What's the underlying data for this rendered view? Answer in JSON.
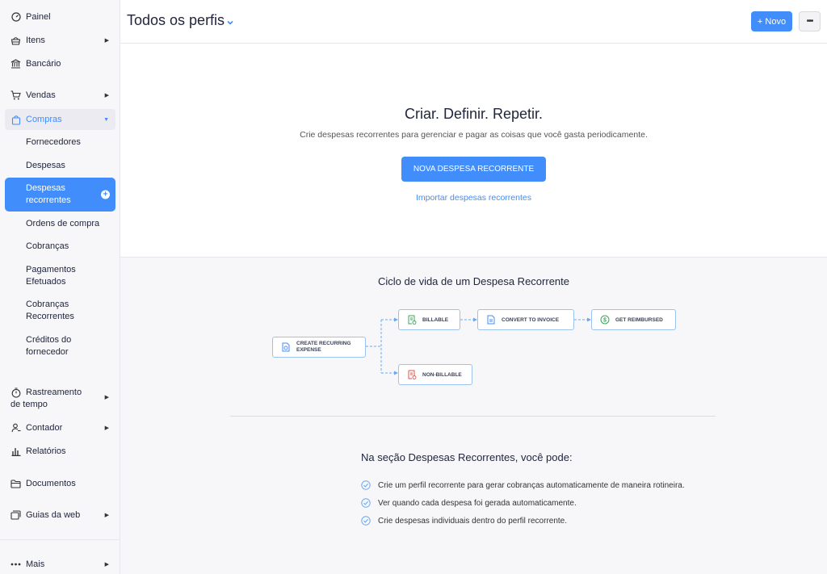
{
  "sidebar": {
    "items": [
      {
        "label": "Painel",
        "icon": "dashboard-icon"
      },
      {
        "label": "Itens",
        "icon": "basket-icon"
      },
      {
        "label": "Bancário",
        "icon": "bank-icon"
      },
      {
        "label": "Vendas",
        "icon": "cart-icon"
      },
      {
        "label": "Compras",
        "icon": "bag-icon"
      },
      {
        "label": "Rastreamento de tempo",
        "icon": "timer-icon"
      },
      {
        "label": "Contador",
        "icon": "accountant-icon"
      },
      {
        "label": "Relatórios",
        "icon": "reports-icon"
      },
      {
        "label": "Documentos",
        "icon": "folder-icon"
      },
      {
        "label": "Guias da web",
        "icon": "web-tabs-icon"
      },
      {
        "label": "Mais",
        "icon": "more-dots-icon"
      }
    ],
    "purchases_sub": [
      "Fornecedores",
      "Despesas",
      "Despesas recorrentes",
      "Ordens de compra",
      "Cobranças",
      "Pagamentos Efetuados",
      "Cobranças Recorrentes",
      "Créditos do fornecedor"
    ],
    "active_sub": "Despesas recorrentes"
  },
  "header": {
    "title": "Todos os perfis",
    "new_button": "+ Novo",
    "more_button": "•••"
  },
  "hero": {
    "title": "Criar. Definir. Repetir.",
    "description": "Crie despesas recorrentes para gerenciar e pagar as coisas que você gasta periodicamente.",
    "primary_button": "NOVA DESPESA RECORRENTE",
    "import_link": "Importar despesas recorrentes"
  },
  "lifecycle": {
    "title": "Ciclo de vida de um Despesa Recorrente",
    "nodes": {
      "create": "CREATE RECURRING EXPENSE",
      "billable": "BILLABLE",
      "non_billable": "NON-BILLABLE",
      "convert": "CONVERT TO INVOICE",
      "reimbursed": "GET REIMBURSED"
    }
  },
  "benefits": {
    "title": "Na seção Despesas Recorrentes, você pode:",
    "items": [
      "Crie um perfil recorrente para gerar cobranças automaticamente de maneira rotineira.",
      "Ver quando cada despesa foi gerada automaticamente.",
      "Crie despesas individuais dentro do perfil recorrente."
    ]
  },
  "colors": {
    "accent": "#408dfb",
    "sidebar_bg": "#f7f7fa",
    "billable_green": "#3aa757",
    "non_billable_red": "#e0564b"
  }
}
